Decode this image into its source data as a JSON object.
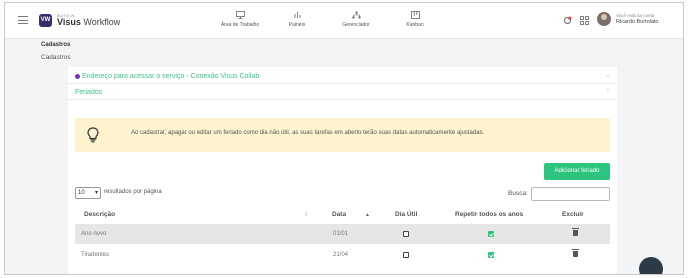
{
  "header": {
    "logo_mark": "VW",
    "brand_small": "BUTO W",
    "brand_bold": "Visus",
    "brand_rest": " Workflow",
    "nav": [
      {
        "label": "Área de Trabalho",
        "icon": "monitor-icon"
      },
      {
        "label": "Painéis",
        "icon": "bar-chart-icon"
      },
      {
        "label": "Gerenciador",
        "icon": "hierarchy-icon"
      },
      {
        "label": "Kanban",
        "icon": "kanban-icon"
      }
    ],
    "user_prefix": "Você está na conta",
    "user_name": "Ricardo Bortolato"
  },
  "breadcrumb": {
    "level1": "Cadastros",
    "level2": "Cadastros"
  },
  "accordions": [
    {
      "title": "Endereço para acessar o serviço - Conexão Visus Collab",
      "expanded": false
    },
    {
      "title": "Feriados",
      "expanded": true
    }
  ],
  "alert": {
    "text": "Ao cadastrar, apagar ou editar um feriado como dia não útil, as suas tarefas em aberto terão suas datas automaticamente ajustadas.",
    "icon": "lightbulb-icon"
  },
  "add_button": "Adicionar feriado",
  "table_controls": {
    "page_length": "10",
    "page_length_label": "resultados por página",
    "search_label": "Busca:"
  },
  "table": {
    "columns": [
      "Descrição",
      "Data",
      "Dia Útil",
      "Repetir todos os anos",
      "Excluir"
    ],
    "rows": [
      {
        "descricao": "Ano novo",
        "data": "01/01",
        "dia_util": false,
        "repetir": true
      },
      {
        "descricao": "Tiradentes",
        "data": "21/04",
        "dia_util": false,
        "repetir": true
      }
    ]
  },
  "colors": {
    "accent_green": "#2dc57e",
    "accordion_title": "#3ec68a",
    "alert_bg": "#fdf3cf",
    "brand_purple": "#3b2a6b"
  }
}
